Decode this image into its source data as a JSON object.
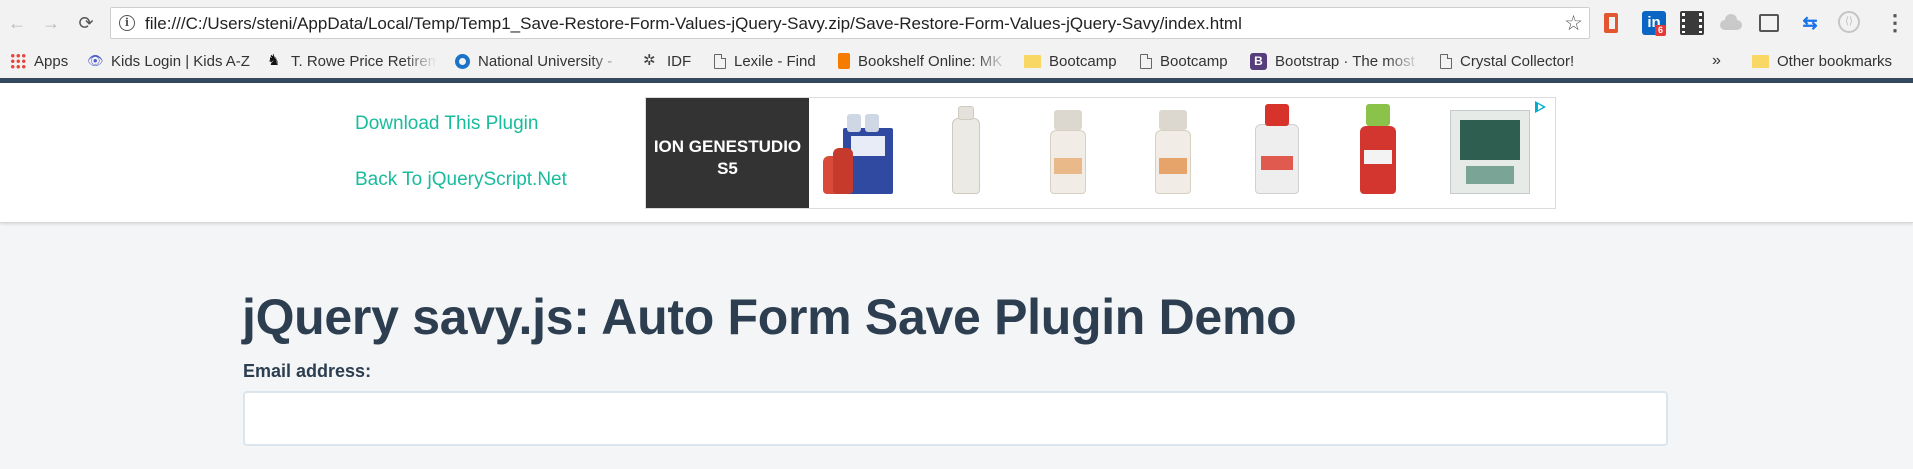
{
  "browser": {
    "url": "file:///C:/Users/steni/AppData/Local/Temp/Temp1_Save-Restore-Form-Values-jQuery-Savy.zip/Save-Restore-Form-Values-jQuery-Savy/index.html",
    "nav_icons": {
      "back": "←",
      "forward": "→",
      "reload": "⟳"
    },
    "star_icon": "☆",
    "info_icon": "i",
    "extensions": {
      "linkedin_label": "in",
      "linkedin_badge": "6",
      "arrows_glyph": "⇆",
      "code_glyph": "⟨⟩"
    },
    "menu_icon": "⋮"
  },
  "bookmarks": {
    "items": [
      {
        "label": "Apps",
        "icon": "apps-grid-icon"
      },
      {
        "label": "Kids Login | Kids A-Z",
        "icon": "eye-icon"
      },
      {
        "label": "T. Rowe Price Retirem",
        "icon": "trowe-price-icon"
      },
      {
        "label": "National University -",
        "icon": "nu-circle-icon"
      },
      {
        "label": "IDF",
        "icon": "idf-icon"
      },
      {
        "label": "Lexile - Find",
        "icon": "page-icon"
      },
      {
        "label": "Bookshelf Online: MK",
        "icon": "bookshelf-icon"
      },
      {
        "label": "Bootcamp",
        "icon": "folder-icon"
      },
      {
        "label": "Bootcamp",
        "icon": "page-icon"
      },
      {
        "label": "Bootstrap · The most",
        "icon": "bootstrap-icon"
      },
      {
        "label": "Crystal Collector!",
        "icon": "page-icon"
      }
    ],
    "glyphs": {
      "troweprice": "♞",
      "idf": "✲",
      "eye": "👁",
      "bootstrap": "B"
    },
    "overflow": "»",
    "other": "Other bookmarks"
  },
  "header": {
    "download_link": "Download This Plugin",
    "back_link": "Back To jQueryScript.Net"
  },
  "ad": {
    "brand_text": "ION GENESTUDIO S5"
  },
  "main": {
    "title": "jQuery savy.js: Auto Form Save Plugin Demo",
    "email_label": "Email address:",
    "email_value": ""
  },
  "colors": {
    "link": "#18bc9c",
    "heading": "#2c3e50",
    "topline": "#34495e",
    "page_bg": "#f4f5f6"
  }
}
